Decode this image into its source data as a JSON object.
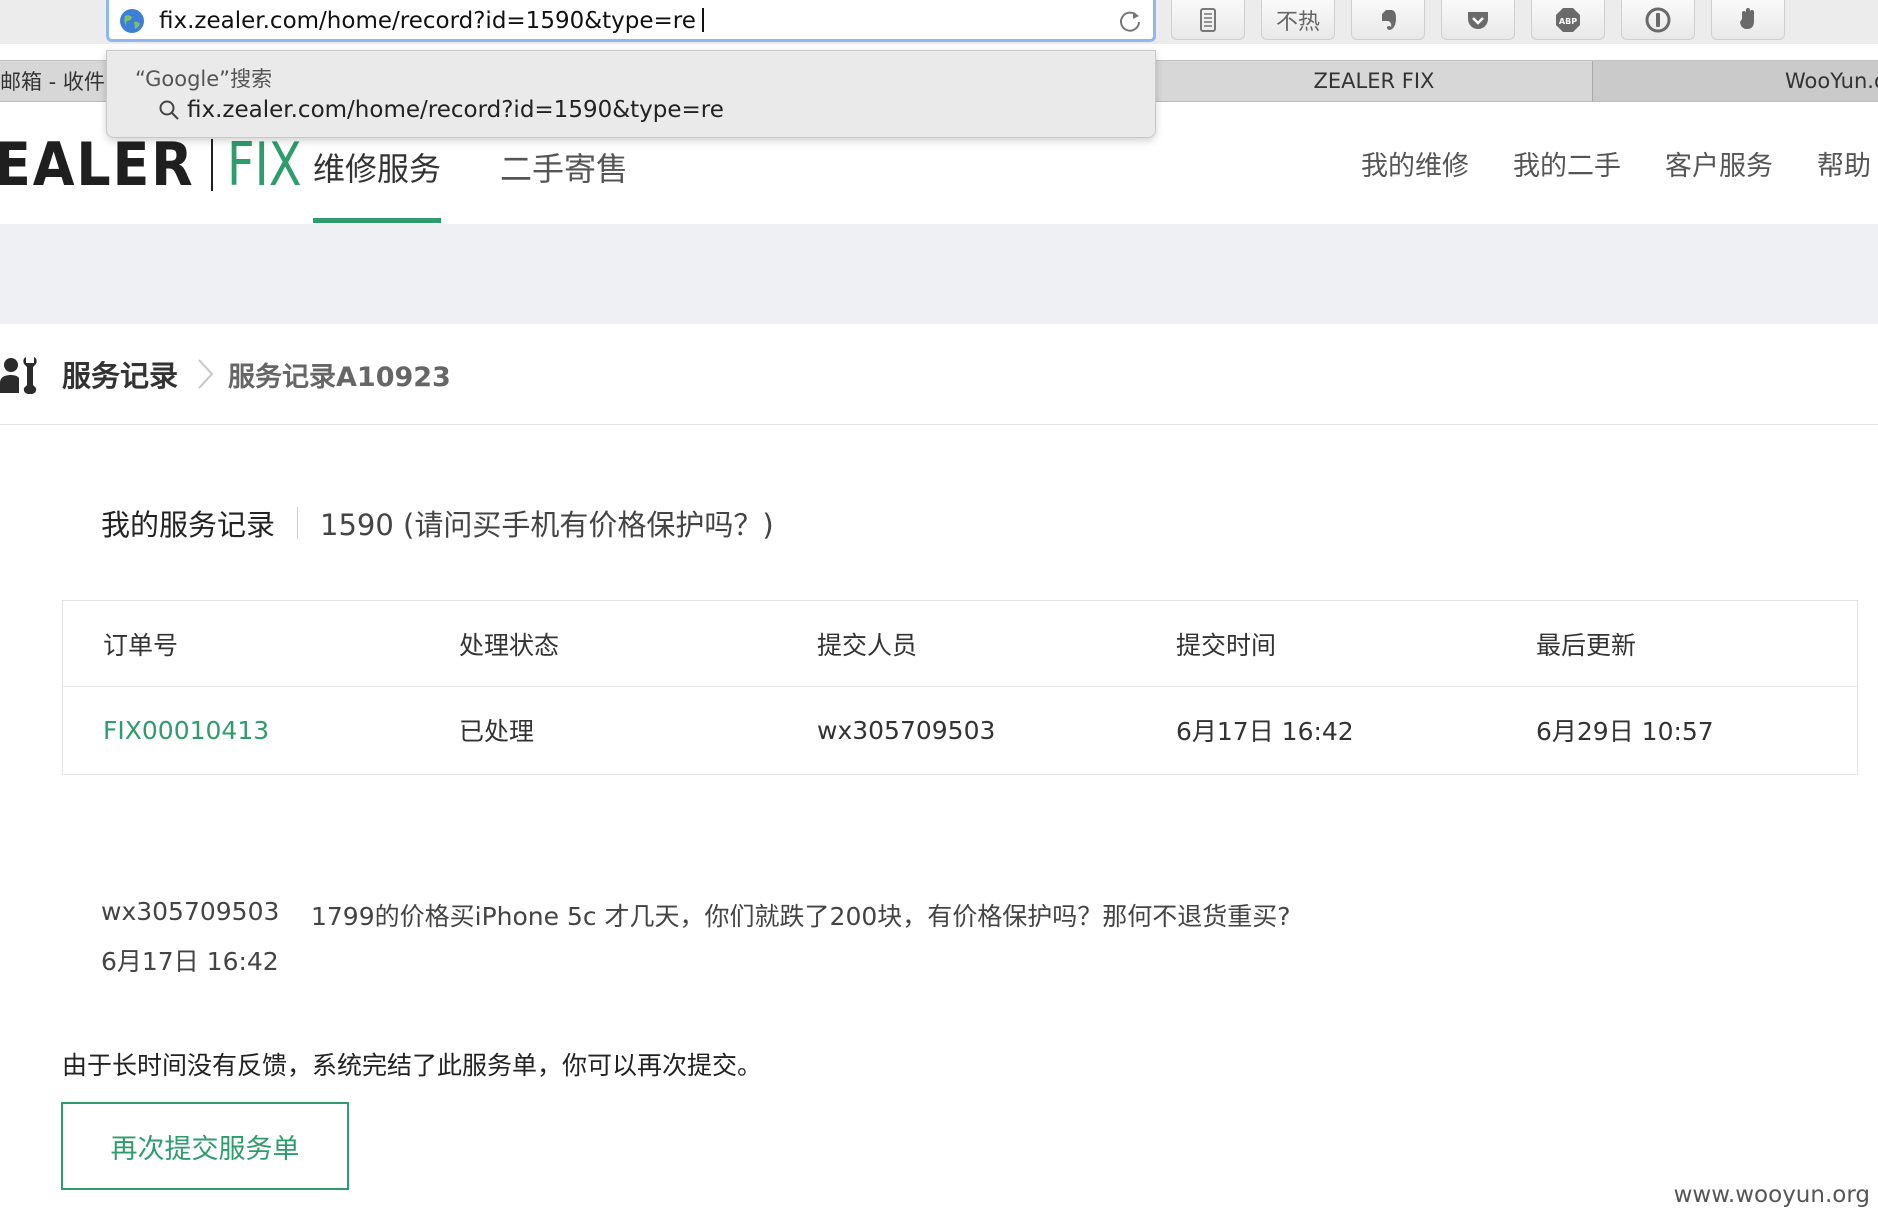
{
  "browser": {
    "url": "fix.zealer.com/home/record?id=1590&type=re",
    "extensions": [
      {
        "icon": "reader-icon"
      },
      {
        "label": "不热",
        "icon": "buere-icon"
      },
      {
        "icon": "evernote-icon"
      },
      {
        "icon": "pocket-icon"
      },
      {
        "label": "ABP",
        "icon": "adblock-icon"
      },
      {
        "icon": "onepassword-icon"
      },
      {
        "icon": "ghostery-icon"
      }
    ],
    "tabs": [
      {
        "label": "邮箱 - 收件"
      },
      {
        "label": "ZEALER FIX"
      },
      {
        "label": "WooYun.o"
      }
    ],
    "suggestion": {
      "header": "“Google”搜索",
      "item": "fix.zealer.com/home/record?id=1590&type=re"
    }
  },
  "header": {
    "logo_main": "EALER",
    "logo_fix": "FIX",
    "nav": [
      "维修服务",
      "二手寄售"
    ],
    "right_nav": [
      "我的维修",
      "我的二手",
      "客户服务",
      "帮助"
    ]
  },
  "breadcrumb": {
    "root": "服务记录",
    "current": "服务记录A10923"
  },
  "record": {
    "title": "我的服务记录",
    "subtitle": "1590 (请问买手机有价格保护吗？)",
    "columns": [
      "订单号",
      "处理状态",
      "提交人员",
      "提交时间",
      "最后更新"
    ],
    "rows": [
      {
        "order": "FIX00010413",
        "status": "已处理",
        "submitter": "wx305709503",
        "submitted": "6月17日 16:42",
        "updated": "6月29日 10:57"
      }
    ]
  },
  "message": {
    "user": "wx305709503",
    "text": "1799的价格买iPhone 5c 才几天，你们就跌了200块，有价格保护吗？那何不退货重买?",
    "time": "6月17日 16:42"
  },
  "notice": "由于长时间没有反馈，系统完结了此服务单，你可以再次提交。",
  "resubmit_label": "再次提交服务单",
  "watermark": "www.wooyun.org",
  "colors": {
    "accent": "#2e9c6c",
    "band": "#eef0f3"
  }
}
